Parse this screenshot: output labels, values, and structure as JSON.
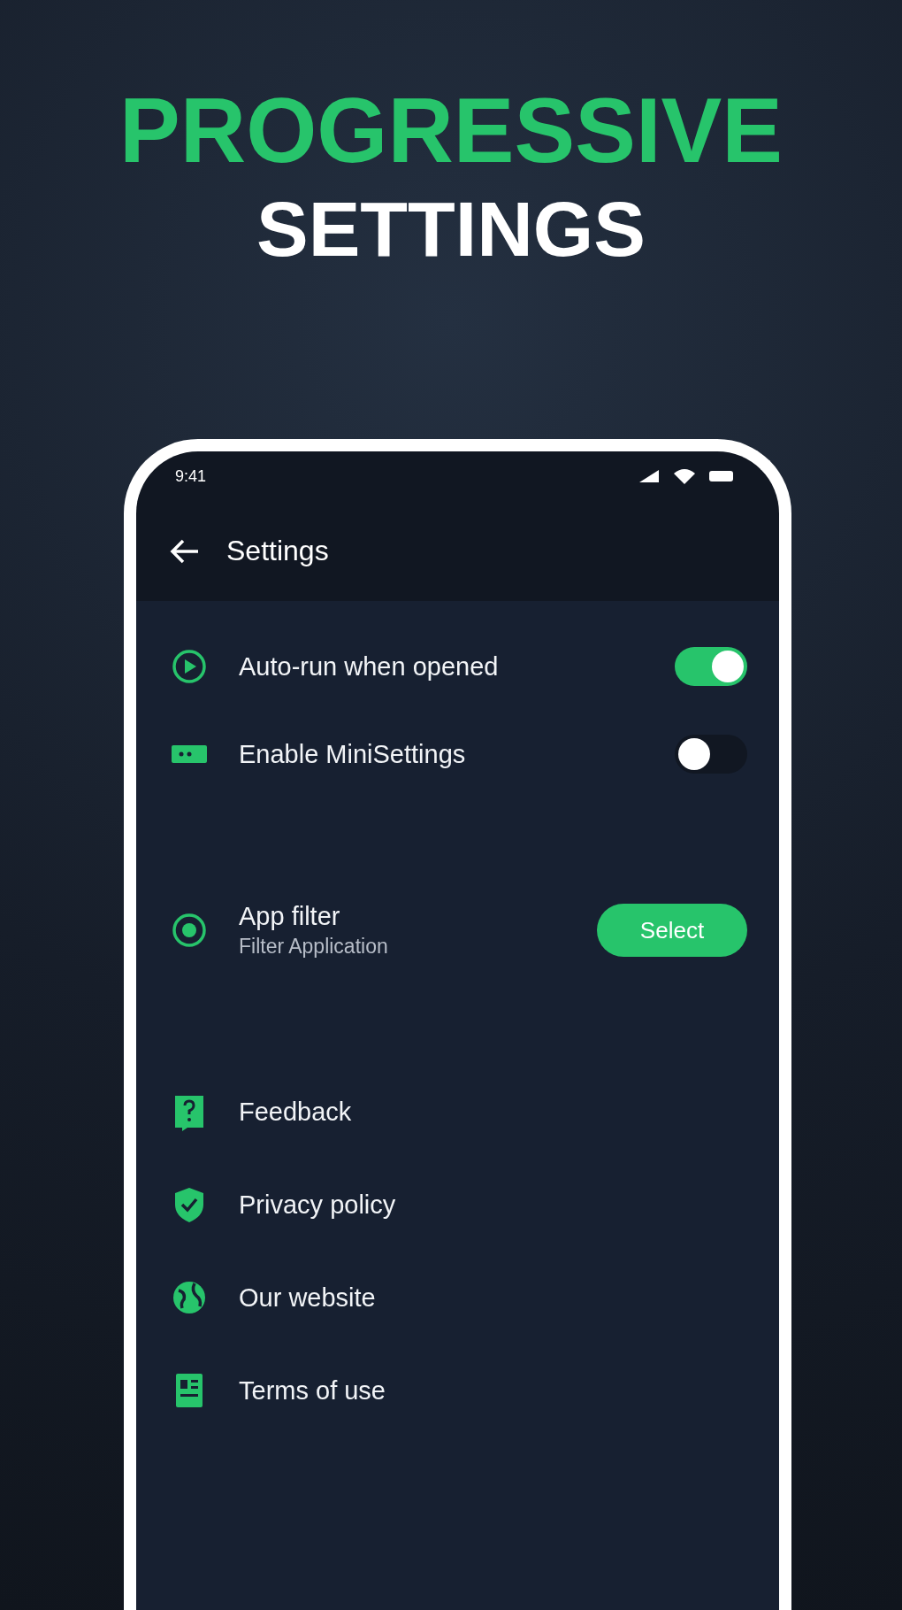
{
  "headline": {
    "line_1": "PROGRESSIVE",
    "line_2": "SETTINGS"
  },
  "status_bar": {
    "time": "9:41"
  },
  "app_bar": {
    "title": "Settings"
  },
  "sections": [
    {
      "items": [
        {
          "kind": "toggle",
          "label": "Auto-run when opened",
          "on": true
        },
        {
          "kind": "toggle",
          "label": "Enable MiniSettings",
          "on": false
        }
      ]
    },
    {
      "items": [
        {
          "kind": "button",
          "label": "App filter",
          "subtitle": "Filter Application",
          "button": "Select"
        }
      ]
    },
    {
      "items": [
        {
          "kind": "link",
          "label": "Feedback"
        },
        {
          "kind": "link",
          "label": "Privacy policy"
        },
        {
          "kind": "link",
          "label": "Our website"
        },
        {
          "kind": "link",
          "label": "Terms of use"
        }
      ]
    }
  ]
}
